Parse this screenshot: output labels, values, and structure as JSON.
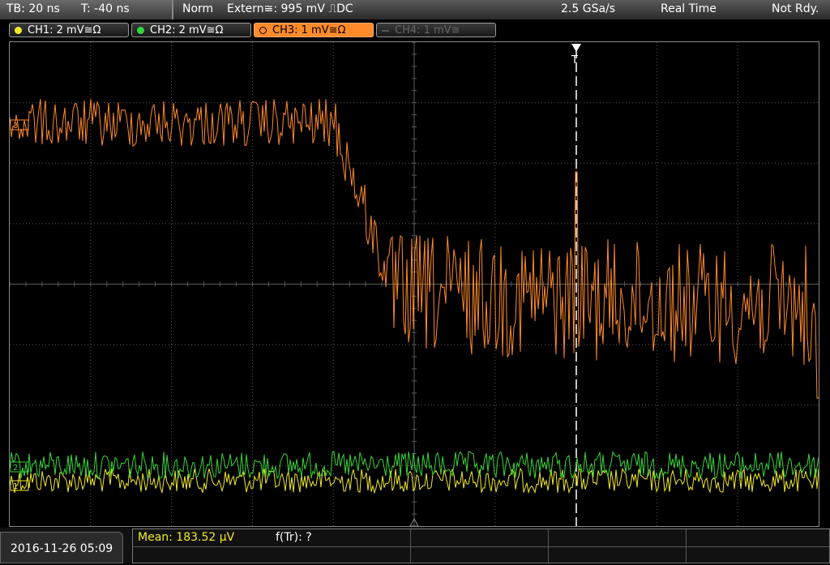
{
  "status": {
    "timebase": "TB: 20 ns",
    "trigger_time": "T: -40 ns",
    "mode": "Norm",
    "trigger_source": "Extern≅: 995 mV ⎍DC",
    "sample_rate": "2.5 GSa/s",
    "acq_mode": "Real Time",
    "state": "Not Rdy."
  },
  "channels": [
    {
      "label": "CH1: 2 mV≅Ω",
      "color": "#f2ea2a",
      "state": "on"
    },
    {
      "label": "CH2: 2 mV≅Ω",
      "color": "#38d63a",
      "state": "on"
    },
    {
      "label": "CH3: 1 mV≅Ω",
      "color": "#ff8a2a",
      "state": "active"
    },
    {
      "label": "CH4: 1 mV≅",
      "color": "#666666",
      "state": "off"
    }
  ],
  "markers": {
    "ch1": "1",
    "ch2": "2",
    "ch3": "3"
  },
  "measurements": {
    "mean": "Mean: 183.52 µV",
    "rise_freq": "f(Tr): ?"
  },
  "date": "2016-11-26 05:09",
  "colors": {
    "ch1": "#f2ea2a",
    "ch2": "#38d63a",
    "ch3": "#ff8a2a",
    "grid": "#5a5a5a"
  }
}
